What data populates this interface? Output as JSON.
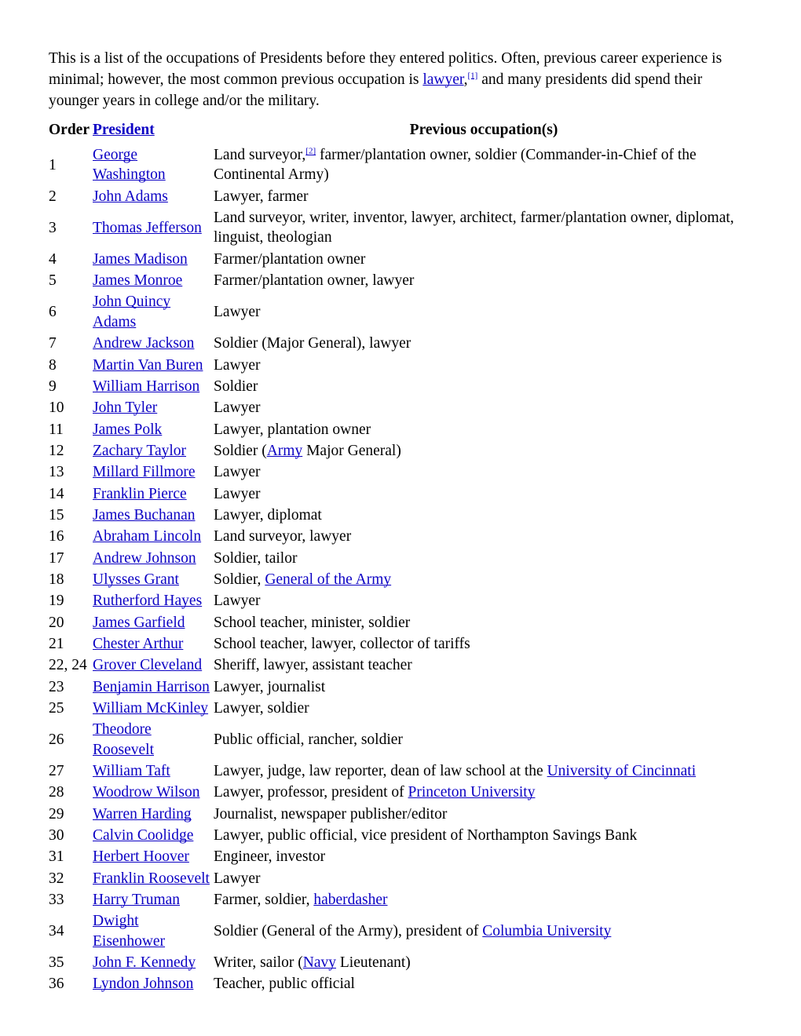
{
  "colors": {
    "link": "#0b00c4",
    "text": "#000000",
    "background": "#ffffff"
  },
  "intro": {
    "part1": "This is a list of the occupations of Presidents before they entered politics. Often, previous career experience is minimal; however, the most common previous occupation is ",
    "link": "lawyer",
    "comma": ",",
    "ref": "[1]",
    "part2": " and many presidents did spend their younger years in college and/or the military."
  },
  "table": {
    "headers": {
      "order": "Order",
      "president": "President",
      "occupation": "Previous occupation(s)"
    },
    "rows": [
      {
        "order": "1",
        "president": "George Washington",
        "occupation_parts": [
          {
            "type": "text",
            "text": "Land surveyor,"
          },
          {
            "type": "ref",
            "text": "[2]"
          },
          {
            "type": "text",
            "text": " farmer/plantation owner, soldier (Commander-in-Chief of the Continental Army)"
          }
        ]
      },
      {
        "order": "2",
        "president": "John Adams",
        "occupation_parts": [
          {
            "type": "text",
            "text": "Lawyer, farmer"
          }
        ]
      },
      {
        "order": "3",
        "president": "Thomas Jefferson",
        "occupation_parts": [
          {
            "type": "text",
            "text": "Land surveyor, writer, inventor, lawyer, architect, farmer/plantation owner, diplomat, linguist, theologian"
          }
        ]
      },
      {
        "order": "4",
        "president": "James Madison",
        "occupation_parts": [
          {
            "type": "text",
            "text": "Farmer/plantation owner"
          }
        ]
      },
      {
        "order": "5",
        "president": "James Monroe",
        "occupation_parts": [
          {
            "type": "text",
            "text": "Farmer/plantation owner, lawyer"
          }
        ]
      },
      {
        "order": "6",
        "president": "John Quincy Adams",
        "occupation_parts": [
          {
            "type": "text",
            "text": "Lawyer"
          }
        ]
      },
      {
        "order": "7",
        "president": "Andrew Jackson",
        "occupation_parts": [
          {
            "type": "text",
            "text": "Soldier (Major General), lawyer"
          }
        ]
      },
      {
        "order": "8",
        "president": "Martin Van Buren",
        "occupation_parts": [
          {
            "type": "text",
            "text": "Lawyer"
          }
        ]
      },
      {
        "order": "9",
        "president": "William Harrison",
        "occupation_parts": [
          {
            "type": "text",
            "text": "Soldier"
          }
        ]
      },
      {
        "order": "10",
        "president": "John Tyler",
        "occupation_parts": [
          {
            "type": "text",
            "text": "Lawyer"
          }
        ]
      },
      {
        "order": "11",
        "president": "James Polk",
        "occupation_parts": [
          {
            "type": "text",
            "text": "Lawyer, plantation owner"
          }
        ]
      },
      {
        "order": "12",
        "president": "Zachary Taylor",
        "occupation_parts": [
          {
            "type": "text",
            "text": "Soldier ("
          },
          {
            "type": "link",
            "text": "Army"
          },
          {
            "type": "text",
            "text": " Major General)"
          }
        ]
      },
      {
        "order": "13",
        "president": "Millard Fillmore",
        "occupation_parts": [
          {
            "type": "text",
            "text": "Lawyer"
          }
        ]
      },
      {
        "order": "14",
        "president": "Franklin Pierce",
        "occupation_parts": [
          {
            "type": "text",
            "text": "Lawyer"
          }
        ]
      },
      {
        "order": "15",
        "president": "James Buchanan",
        "occupation_parts": [
          {
            "type": "text",
            "text": "Lawyer, diplomat"
          }
        ]
      },
      {
        "order": "16",
        "president": "Abraham Lincoln",
        "occupation_parts": [
          {
            "type": "text",
            "text": "Land surveyor, lawyer"
          }
        ]
      },
      {
        "order": "17",
        "president": "Andrew Johnson",
        "occupation_parts": [
          {
            "type": "text",
            "text": "Soldier, tailor"
          }
        ]
      },
      {
        "order": "18",
        "president": "Ulysses Grant",
        "occupation_parts": [
          {
            "type": "text",
            "text": "Soldier, "
          },
          {
            "type": "link",
            "text": "General of the Army"
          }
        ]
      },
      {
        "order": "19",
        "president": "Rutherford Hayes",
        "occupation_parts": [
          {
            "type": "text",
            "text": "Lawyer"
          }
        ]
      },
      {
        "order": "20",
        "president": "James Garfield",
        "occupation_parts": [
          {
            "type": "text",
            "text": "School teacher, minister, soldier"
          }
        ]
      },
      {
        "order": "21",
        "president": "Chester Arthur",
        "occupation_parts": [
          {
            "type": "text",
            "text": "School teacher, lawyer, collector of tariffs"
          }
        ]
      },
      {
        "order": "22, 24",
        "president": "Grover Cleveland",
        "occupation_parts": [
          {
            "type": "text",
            "text": "Sheriff, lawyer, assistant teacher"
          }
        ]
      },
      {
        "order": "23",
        "president": "Benjamin Harrison",
        "occupation_parts": [
          {
            "type": "text",
            "text": "Lawyer, journalist"
          }
        ]
      },
      {
        "order": "25",
        "president": "William McKinley",
        "occupation_parts": [
          {
            "type": "text",
            "text": "Lawyer, soldier"
          }
        ]
      },
      {
        "order": "26",
        "president": "Theodore Roosevelt",
        "occupation_parts": [
          {
            "type": "text",
            "text": "Public official, rancher, soldier"
          }
        ]
      },
      {
        "order": "27",
        "president": "William Taft",
        "occupation_parts": [
          {
            "type": "text",
            "text": "Lawyer, judge, law reporter, dean of law school at the "
          },
          {
            "type": "link",
            "text": "University of Cincinnati"
          }
        ]
      },
      {
        "order": "28",
        "president": "Woodrow Wilson",
        "occupation_parts": [
          {
            "type": "text",
            "text": "Lawyer, professor, president of "
          },
          {
            "type": "link",
            "text": "Princeton University"
          }
        ]
      },
      {
        "order": "29",
        "president": "Warren Harding",
        "occupation_parts": [
          {
            "type": "text",
            "text": "Journalist, newspaper publisher/editor"
          }
        ]
      },
      {
        "order": "30",
        "president": "Calvin Coolidge",
        "occupation_parts": [
          {
            "type": "text",
            "text": "Lawyer, public official, vice president of Northampton Savings Bank"
          }
        ]
      },
      {
        "order": "31",
        "president": "Herbert Hoover",
        "occupation_parts": [
          {
            "type": "text",
            "text": "Engineer, investor"
          }
        ]
      },
      {
        "order": "32",
        "president": "Franklin Roosevelt",
        "occupation_parts": [
          {
            "type": "text",
            "text": "Lawyer"
          }
        ]
      },
      {
        "order": "33",
        "president": "Harry Truman",
        "occupation_parts": [
          {
            "type": "text",
            "text": "Farmer, soldier, "
          },
          {
            "type": "link",
            "text": "haberdasher"
          }
        ]
      },
      {
        "order": "34",
        "president": "Dwight Eisenhower",
        "occupation_parts": [
          {
            "type": "text",
            "text": "Soldier (General of the Army), president of "
          },
          {
            "type": "link",
            "text": "Columbia University"
          }
        ]
      },
      {
        "order": "35",
        "president": "John F. Kennedy",
        "occupation_parts": [
          {
            "type": "text",
            "text": "Writer, sailor ("
          },
          {
            "type": "link",
            "text": "Navy"
          },
          {
            "type": "text",
            "text": " Lieutenant)"
          }
        ]
      },
      {
        "order": "36",
        "president": "Lyndon Johnson",
        "occupation_parts": [
          {
            "type": "text",
            "text": "Teacher, public official"
          }
        ]
      }
    ]
  }
}
